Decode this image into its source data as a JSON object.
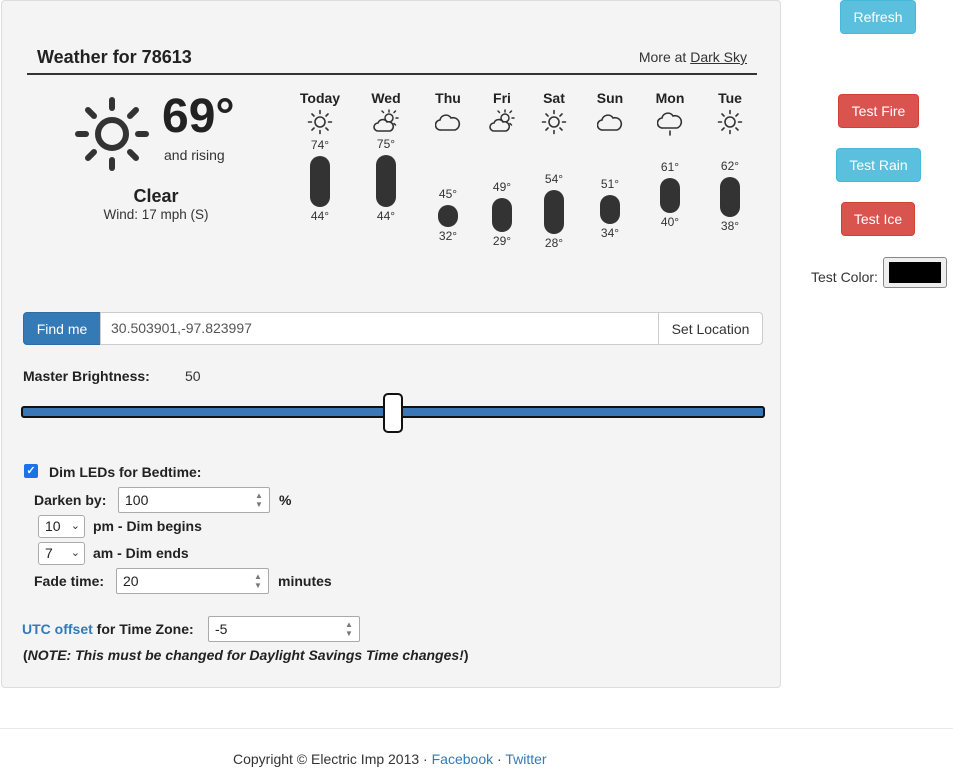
{
  "weather": {
    "title": "Weather for 78613",
    "more_prefix": "More at",
    "more_link": "Dark Sky",
    "current": {
      "temp": "69°",
      "trend": "and rising",
      "condition": "Clear",
      "wind": "Wind: 17 mph (S)",
      "icon": "sun-icon"
    },
    "days": [
      {
        "name": "Today",
        "icon": "clear-day-icon",
        "high": "74°",
        "low": "44°"
      },
      {
        "name": "Wed",
        "icon": "partly-cloudy-icon",
        "high": "75°",
        "low": "44°"
      },
      {
        "name": "Thu",
        "icon": "cloudy-icon",
        "high": "45°",
        "low": "32°"
      },
      {
        "name": "Fri",
        "icon": "partly-cloudy-icon",
        "high": "49°",
        "low": "29°"
      },
      {
        "name": "Sat",
        "icon": "clear-day-icon",
        "high": "54°",
        "low": "28°"
      },
      {
        "name": "Sun",
        "icon": "cloudy-icon",
        "high": "51°",
        "low": "34°"
      },
      {
        "name": "Mon",
        "icon": "rain-icon",
        "high": "61°",
        "low": "40°"
      },
      {
        "name": "Tue",
        "icon": "clear-day-icon",
        "high": "62°",
        "low": "38°"
      }
    ]
  },
  "location": {
    "find_me_label": "Find me",
    "value": "30.503901,-97.823997",
    "set_location_label": "Set Location"
  },
  "brightness": {
    "label": "Master Brightness:",
    "value": "50",
    "min": 0,
    "max": 100,
    "track_color": "#3a77b7"
  },
  "bedtime": {
    "checked": true,
    "label": "Dim LEDs for Bedtime:",
    "darken_label": "Darken by:",
    "darken_value": "100",
    "darken_unit": "%",
    "begin_value": "10",
    "begin_label": "pm - Dim begins",
    "end_value": "7",
    "end_label": "am - Dim ends",
    "fade_label": "Fade time:",
    "fade_value": "20",
    "fade_unit": "minutes"
  },
  "timezone": {
    "link_label": "UTC offset",
    "label": "for Time Zone:",
    "value": "-5",
    "note_open": "(",
    "note": "NOTE: This must be changed for Daylight Savings Time changes!",
    "note_close": ")"
  },
  "side_buttons": {
    "refresh": "Refresh",
    "test_fire": "Test Fire",
    "test_rain": "Test Rain",
    "test_ice": "Test Ice",
    "test_color_label": "Test Color:",
    "test_color_value": "#000000"
  },
  "colors": {
    "primary": "#337ab7",
    "info": "#5bc0de",
    "danger": "#d9534f"
  },
  "footer": {
    "copyright": "Copyright © Electric Imp 2013 ·",
    "facebook": "Facebook",
    "separator": "·",
    "twitter": "Twitter"
  }
}
